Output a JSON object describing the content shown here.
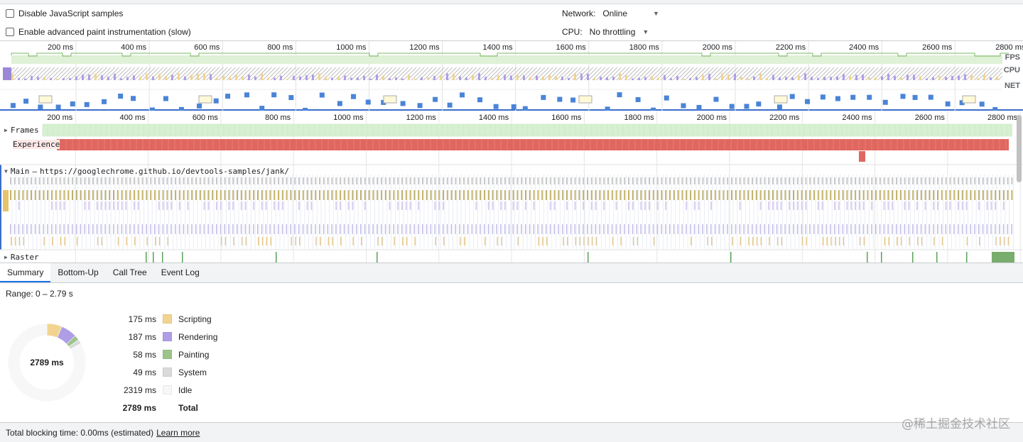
{
  "settings": {
    "disable_js_samples": "Disable JavaScript samples",
    "advanced_paint": "Enable advanced paint instrumentation (slow)",
    "network_label": "Network:",
    "network_value": "Online",
    "cpu_label": "CPU:",
    "cpu_value": "No throttling"
  },
  "overview": {
    "ticks": [
      "200 ms",
      "400 ms",
      "600 ms",
      "800 ms",
      "1000 ms",
      "1200 ms",
      "1400 ms",
      "1600 ms",
      "1800 ms",
      "2000 ms",
      "2200 ms",
      "2400 ms",
      "2600 ms",
      "2800 ms"
    ],
    "lanes": {
      "fps": "FPS",
      "cpu": "CPU",
      "net": "NET"
    }
  },
  "tracks": {
    "frames": "Frames",
    "experience": "Experience",
    "main_label": "Main",
    "main_sep": "—",
    "main_url": "https://googlechrome.github.io/devtools-samples/jank/",
    "raster": "Raster"
  },
  "tabs": [
    "Summary",
    "Bottom-Up",
    "Call Tree",
    "Event Log"
  ],
  "summary": {
    "range": "Range: 0 – 2.79 s",
    "total_center": "2789 ms",
    "rows": [
      {
        "value": "175 ms",
        "name": "Scripting",
        "color": "#f2d491"
      },
      {
        "value": "187 ms",
        "name": "Rendering",
        "color": "#af9ee6"
      },
      {
        "value": "58 ms",
        "name": "Painting",
        "color": "#9dc48a"
      },
      {
        "value": "49 ms",
        "name": "System",
        "color": "#dadada"
      },
      {
        "value": "2319 ms",
        "name": "Idle",
        "color": "#f7f7f7"
      }
    ],
    "total": {
      "value": "2789 ms",
      "name": "Total"
    }
  },
  "footer": {
    "text": "Total blocking time: 0.00ms (estimated)",
    "link": "Learn more"
  },
  "watermark": "@稀土掘金技术社区"
}
